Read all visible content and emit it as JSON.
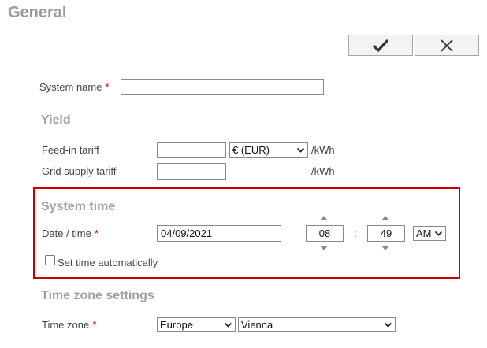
{
  "page": {
    "title": "General"
  },
  "toolbar": {
    "confirm_icon": "checkmark-icon",
    "cancel_icon": "close-icon"
  },
  "system": {
    "name_label": "System name",
    "required_mark": "*",
    "name_value": ""
  },
  "yield": {
    "title": "Yield",
    "feed_in_label": "Feed-in tariff",
    "feed_in_value": "",
    "currency_selected": "€ (EUR)",
    "feed_in_unit": "/kWh",
    "grid_supply_label": "Grid supply tariff",
    "grid_supply_value": "",
    "grid_supply_unit": "/kWh"
  },
  "system_time": {
    "title": "System time",
    "datetime_label": "Date / time",
    "date_value": "04/09/2021",
    "hour_value": "08",
    "separator": ":",
    "minute_value": "49",
    "ampm_selected": "AM",
    "auto_label": "Set time automatically",
    "auto_checked": false
  },
  "timezone": {
    "title": "Time zone settings",
    "label": "Time zone",
    "region_selected": "Europe",
    "city_selected": "Vienna"
  },
  "colors": {
    "highlight": "#c80000",
    "section_title": "#a0a0a0",
    "required": "#cc0000"
  }
}
